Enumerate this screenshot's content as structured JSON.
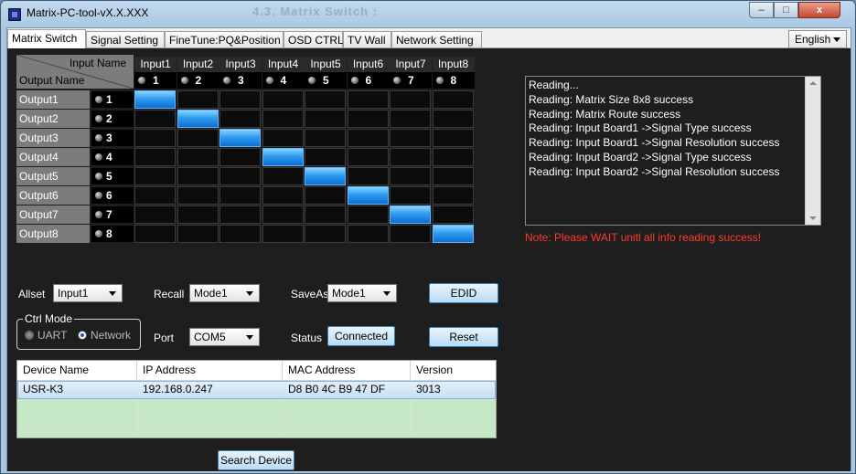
{
  "window": {
    "title": "Matrix-PC-tool-vX.X.XXX",
    "ghost_title": "4.3.  Matrix Switch :",
    "minimize_glyph": "–",
    "maximize_glyph": "□",
    "close_glyph": "x"
  },
  "tabs": [
    "Matrix Switch",
    "Signal Setting",
    "FineTune:PQ&Position",
    "OSD CTRL",
    "TV Wall",
    "Network Setting"
  ],
  "active_tab": "Matrix Switch",
  "language": "English",
  "matrix": {
    "corner_input_label": "Input Name",
    "corner_output_label": "Output Name",
    "inputs": [
      {
        "name": "Input1",
        "num": "1"
      },
      {
        "name": "Input2",
        "num": "2"
      },
      {
        "name": "Input3",
        "num": "3"
      },
      {
        "name": "Input4",
        "num": "4"
      },
      {
        "name": "Input5",
        "num": "5"
      },
      {
        "name": "Input6",
        "num": "6"
      },
      {
        "name": "Input7",
        "num": "7"
      },
      {
        "name": "Input8",
        "num": "8"
      }
    ],
    "outputs": [
      {
        "name": "Output1",
        "num": "1"
      },
      {
        "name": "Output2",
        "num": "2"
      },
      {
        "name": "Output3",
        "num": "3"
      },
      {
        "name": "Output4",
        "num": "4"
      },
      {
        "name": "Output5",
        "num": "5"
      },
      {
        "name": "Output6",
        "num": "6"
      },
      {
        "name": "Output7",
        "num": "7"
      },
      {
        "name": "Output8",
        "num": "8"
      }
    ],
    "routes": [
      1,
      2,
      3,
      4,
      5,
      6,
      7,
      8
    ],
    "active_color": "#2e9cf0"
  },
  "controls": {
    "allset_label": "Allset",
    "allset_value": "Input1",
    "recall_label": "Recall",
    "recall_value": "Mode1",
    "saveas_label": "SaveAs",
    "saveas_value": "Mode1",
    "edid_label": "EDID",
    "ctrl_mode_label": "Ctrl Mode",
    "uart_label": "UART",
    "network_label": "Network",
    "ctrl_mode_selected": "Network",
    "port_label": "Port",
    "port_value": "COM5",
    "status_label": "Status",
    "status_value": "Connected",
    "reset_label": "Reset"
  },
  "log": {
    "lines": [
      "Reading...",
      "Reading: Matrix Size 8x8 success",
      "Reading: Matrix Route success",
      "Reading: Input Board1 ->Signal Type success",
      "Reading: Input Board1 ->Signal Resolution success",
      "Reading: Input Board2 ->Signal Type success",
      "Reading: Input Board2 ->Signal Resolution success"
    ],
    "note": "Note: Please WAIT unitl all info reading success!",
    "note_color": "#ff3a2a"
  },
  "devices": {
    "columns": [
      "Device Name",
      "IP Address",
      "MAC Address",
      "Version"
    ],
    "rows": [
      [
        "USR-K3",
        "192.168.0.247",
        "D8 B0 4C B9 47 DF",
        "3013"
      ]
    ],
    "search_label": "Search Device"
  }
}
